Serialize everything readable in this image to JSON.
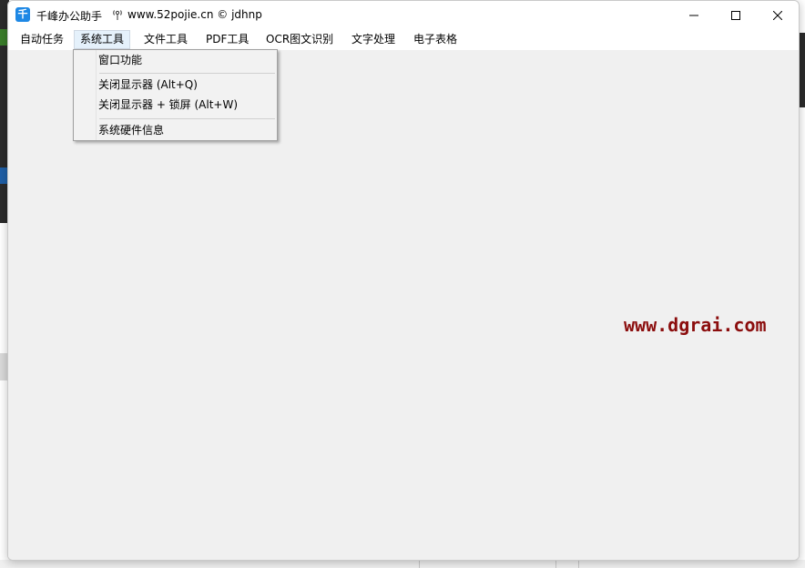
{
  "window": {
    "app_title": "千峰办公助手",
    "title_url": "www.52pojie.cn © jdhnp",
    "app_icon_glyph": "千",
    "minimize_icon": "minimize-icon",
    "maximize_icon": "maximize-icon",
    "close_icon": "close-icon"
  },
  "menubar": {
    "items": [
      {
        "label": "自动任务"
      },
      {
        "label": "系统工具",
        "open": true
      },
      {
        "label": "文件工具"
      },
      {
        "label": "PDF工具"
      },
      {
        "label": "OCR图文识别"
      },
      {
        "label": "文字处理"
      },
      {
        "label": "电子表格"
      }
    ]
  },
  "dropdown": {
    "items": [
      {
        "label": "窗口功能"
      },
      {
        "label": "关闭显示器 (Alt+Q)"
      },
      {
        "label": "关闭显示器 + 锁屏 (Alt+W)"
      },
      {
        "label": "系统硬件信息"
      }
    ]
  },
  "watermark": {
    "text": "www.dgrai.com",
    "color": "#8b0d0d"
  },
  "colors": {
    "menu_open_bg": "#e5f1fb",
    "app_icon_bg": "#1e88e5"
  }
}
